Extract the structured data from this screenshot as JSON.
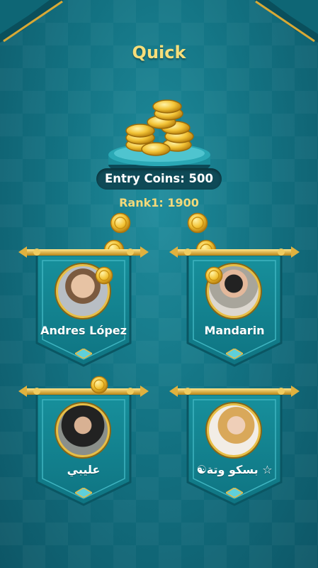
{
  "screen": {
    "title": "Quick"
  },
  "entry": {
    "label": "Entry Coins: 500"
  },
  "rank": {
    "label": "Rank1: 1900"
  },
  "colors": {
    "background": "#137282",
    "banner": "#13828f",
    "gold": "#e8be45",
    "title": "#f6de7a"
  },
  "players": [
    {
      "name": "Andres López",
      "avatar": "avatar-man-long-hair",
      "coin_badge": true
    },
    {
      "name": "Mandarin",
      "avatar": "avatar-woman-sunglasses",
      "coin_badge": true
    },
    {
      "name": "عليبي",
      "avatar": "avatar-man-street",
      "coin_badge": false
    },
    {
      "name": "☯بسكو وتة ☆",
      "avatar": "avatar-woman-blonde",
      "coin_badge": false
    }
  ]
}
